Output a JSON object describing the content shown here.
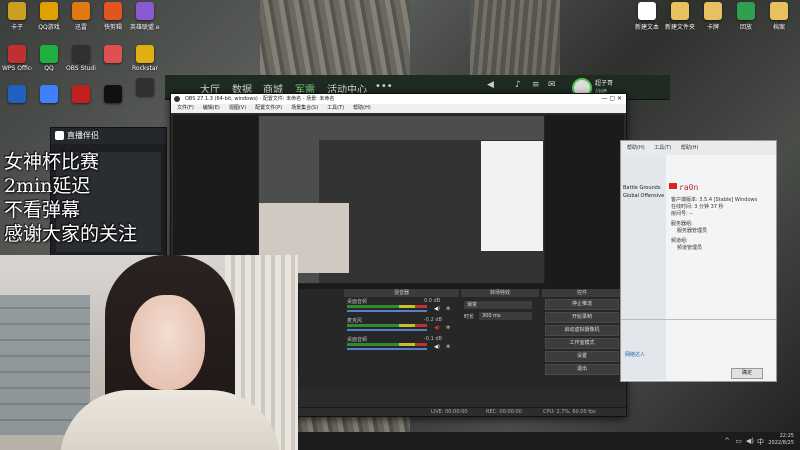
{
  "desktop": {
    "left_icons": [
      {
        "label": "卡子",
        "color": "#c9a020"
      },
      {
        "label": "QQ游戏",
        "color": "#e0a000"
      },
      {
        "label": "迅雷",
        "color": "#e07a10"
      },
      {
        "label": "快剪辑",
        "color": "#e05520"
      },
      {
        "label": "英雄联盟.exe",
        "color": "#8a5ad0"
      },
      {
        "label": "WPS Office",
        "color": "#c03030"
      },
      {
        "label": "QQ",
        "color": "#20b040"
      },
      {
        "label": "OBS Studio",
        "color": "#303030"
      },
      {
        "label": "",
        "color": "#e05050"
      },
      {
        "label": "Rockstar",
        "color": "#e0b010"
      },
      {
        "label": "",
        "color": "#2060c0"
      },
      {
        "label": "",
        "color": "#4080ff"
      },
      {
        "label": "",
        "color": "#c02020"
      },
      {
        "label": "",
        "color": "#101010"
      },
      {
        "label": "",
        "color": "#303030"
      }
    ],
    "right_icons": [
      {
        "label": "新建文本",
        "color": "#ffffff"
      },
      {
        "label": "新建文件夹",
        "color": "#e8c060"
      },
      {
        "label": "卡牌",
        "color": "#e8c060"
      },
      {
        "label": "回放",
        "color": "#30a050"
      },
      {
        "label": "档案",
        "color": "#e8c060"
      }
    ]
  },
  "launcher": {
    "nav": [
      "大厅",
      "数据",
      "商城",
      "军需",
      "活动中心",
      "•••"
    ],
    "user": "超子哥",
    "sub": "战绩"
  },
  "obs": {
    "title": "OBS 27.1.3 (64-bit, windows) - 配置文件: 未命名 - 场景: 未命名",
    "menu": [
      "文件(F)",
      "编辑(E)",
      "视图(V)",
      "配置文件(P)",
      "场景集合(S)",
      "工具(T)",
      "帮助(H)"
    ],
    "panels": {
      "mixer": "混音器",
      "transitions": "转场特效",
      "controls": "控件"
    },
    "mixer_rows": [
      {
        "name": "桌面音频",
        "db": "0.0 dB"
      },
      {
        "name": "麦克风",
        "db": "-0.2 dB"
      },
      {
        "name": "桌面音频",
        "db": "-0.1 dB"
      }
    ],
    "transition": {
      "value": "渐变",
      "duration_label": "时长",
      "duration": "300 ms"
    },
    "controls": [
      "停止推流",
      "开始录制",
      "启动虚拟摄像机",
      "工作室模式",
      "设置",
      "退出"
    ],
    "status": {
      "live": "LIVE: 00:00:00",
      "rec": "REC: 00:00:00",
      "cpu": "CPU: 2.7%, 60.00 fps"
    }
  },
  "assistant": {
    "title": "直播伴侣"
  },
  "overlay": {
    "lines": [
      "女神杯比赛",
      "2min延迟",
      "不看弹幕",
      "感谢大家的关注"
    ]
  },
  "chat": {
    "menu": [
      "帮助(H)",
      "工具(T)",
      "帮助(H)"
    ],
    "name": "ra0n",
    "info": [
      "客户端版本: 3.5.4 [Stable] Windows",
      "在线时间: 3 分钟 37 秒",
      "房间号: --",
      "服务器组:",
      "频道组:"
    ],
    "group_admin": "服务器管理员",
    "group_channel": "频道管理员",
    "side_items": [
      "Battle Grounds",
      "Global Offensive"
    ],
    "footer_btn": "确定",
    "footer_link": "网络达人"
  },
  "taskbar": {
    "time": "22:25",
    "date": "2022/8/25"
  }
}
